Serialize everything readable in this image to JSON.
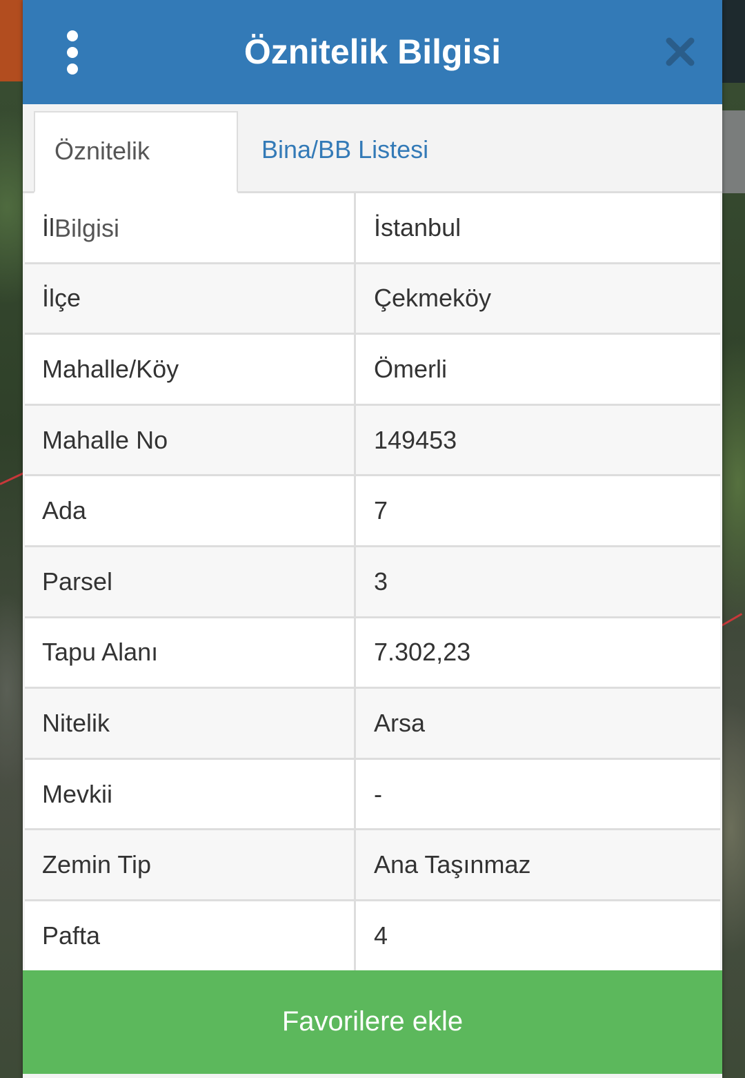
{
  "header": {
    "title": "Öznitelik Bilgisi",
    "menu_icon": "vertical-dots-icon",
    "close_icon": "close-icon"
  },
  "tabs": [
    {
      "label": "Öznitelik Bilgisi",
      "active": true
    },
    {
      "label": "Bina/BB Listesi",
      "active": false
    }
  ],
  "attributes": [
    {
      "key": "İl",
      "value": "İstanbul"
    },
    {
      "key": "İlçe",
      "value": "Çekmeköy"
    },
    {
      "key": "Mahalle/Köy",
      "value": "Ömerli"
    },
    {
      "key": "Mahalle No",
      "value": "149453"
    },
    {
      "key": "Ada",
      "value": "7"
    },
    {
      "key": "Parsel",
      "value": "3"
    },
    {
      "key": "Tapu Alanı",
      "value": "7.302,23"
    },
    {
      "key": "Nitelik",
      "value": "Arsa"
    },
    {
      "key": "Mevkii",
      "value": "-"
    },
    {
      "key": "Zemin Tip",
      "value": "Ana Taşınmaz"
    },
    {
      "key": "Pafta",
      "value": "4"
    }
  ],
  "footer": {
    "favorite_label": "Favorilere ekle"
  },
  "colors": {
    "header": "#337ab7",
    "link": "#337ab7",
    "button": "#5cb85c"
  }
}
